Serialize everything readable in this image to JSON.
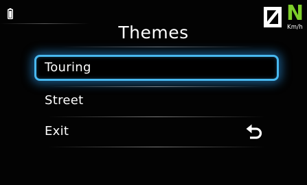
{
  "status": {
    "battery_icon": "battery-icon",
    "speed_value_icon": "zero-digit-icon",
    "gear": "N",
    "speed_unit": "Km/h"
  },
  "screen": {
    "title": "Themes"
  },
  "menu": {
    "items": [
      {
        "label": "Touring",
        "selected": true
      },
      {
        "label": "Street",
        "selected": false
      },
      {
        "label": "Exit",
        "selected": false,
        "icon": "back-arrow-icon"
      }
    ]
  },
  "colors": {
    "background": "#030303",
    "highlight": "#48b8ef",
    "gear_neutral": "#7dcd2a",
    "text": "#ffffff"
  }
}
